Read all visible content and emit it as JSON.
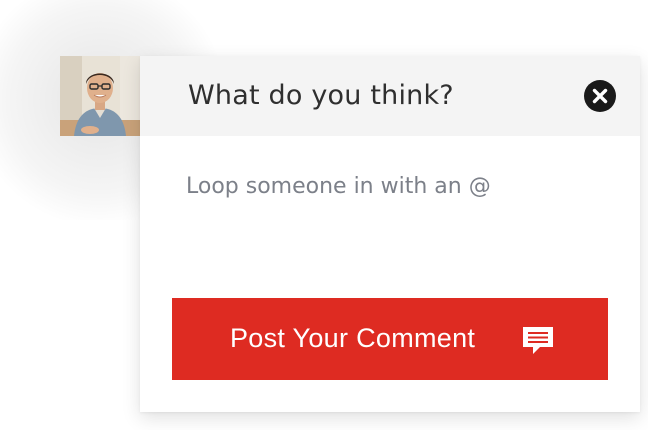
{
  "comment_box": {
    "title": "What do you think?",
    "input_placeholder": "Loop someone in with an @",
    "input_value": "",
    "post_button_label": "Post Your Comment"
  },
  "icons": {
    "close": "close-icon",
    "comment": "comment-bubble-icon",
    "avatar": "user-avatar"
  },
  "colors": {
    "accent": "#de2b22",
    "header_background": "#f4f4f4",
    "close_button": "#1a1a1a",
    "placeholder_text": "#7c8089"
  }
}
